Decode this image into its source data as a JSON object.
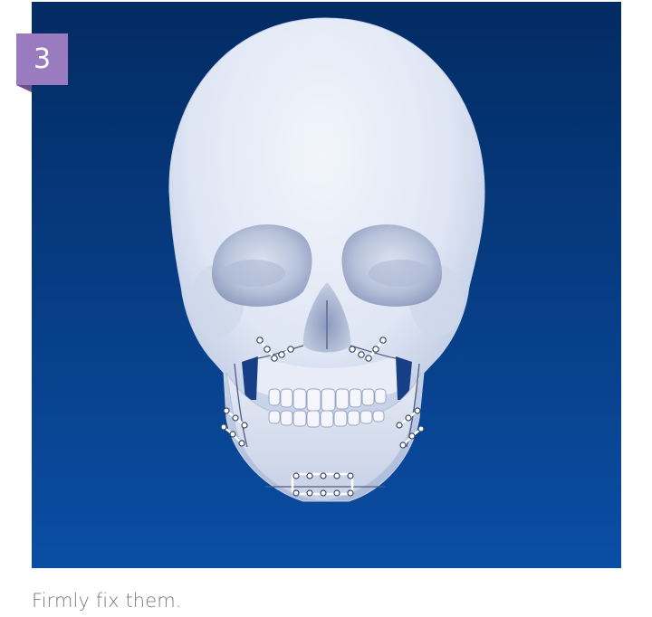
{
  "step": {
    "number": "3",
    "badge_color": "#9b7bbf"
  },
  "illustration": {
    "subject": "skull-with-fixation-plates",
    "background_top": "#032b63",
    "background_bottom": "#0a4ea4"
  },
  "caption": {
    "text": "Firmly fix them."
  }
}
